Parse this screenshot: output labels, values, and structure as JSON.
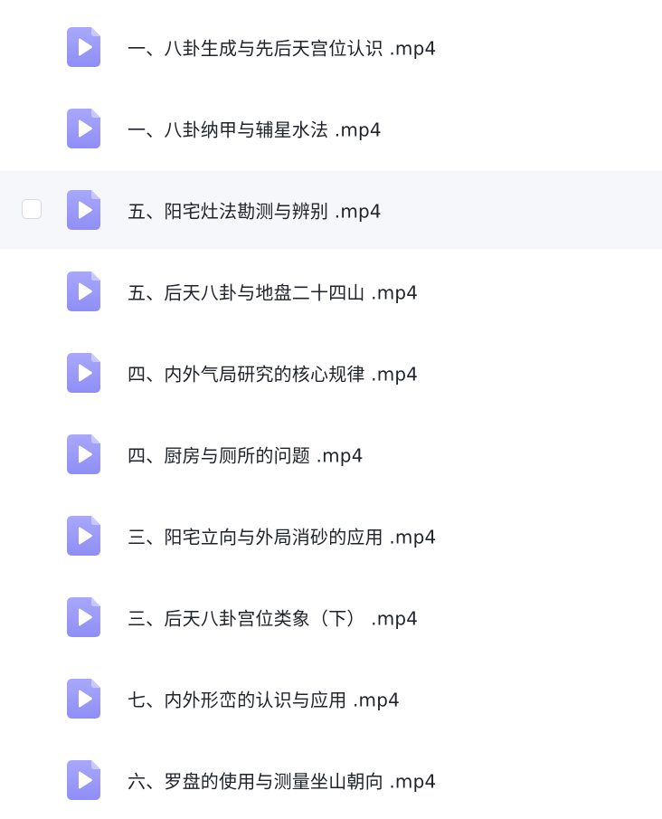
{
  "files": [
    {
      "name": "一、八卦生成与先后天宫位认识 .mp4",
      "icon": "video-file-icon"
    },
    {
      "name": "一、八卦纳甲与辅星水法 .mp4",
      "icon": "video-file-icon"
    },
    {
      "name": "五、阳宅灶法勘测与辨别 .mp4",
      "icon": "video-file-icon",
      "hovered": true
    },
    {
      "name": "五、后天八卦与地盘二十四山 .mp4",
      "icon": "video-file-icon"
    },
    {
      "name": "四、内外气局研究的核心规律 .mp4",
      "icon": "video-file-icon"
    },
    {
      "name": "四、厨房与厕所的问题 .mp4",
      "icon": "video-file-icon"
    },
    {
      "name": "三、阳宅立向与外局消砂的应用 .mp4",
      "icon": "video-file-icon"
    },
    {
      "name": "三、后天八卦宫位类象（下） .mp4",
      "icon": "video-file-icon"
    },
    {
      "name": "七、内外形峦的认识与应用 .mp4",
      "icon": "video-file-icon"
    },
    {
      "name": "六、罗盘的使用与测量坐山朝向 .mp4",
      "icon": "video-file-icon"
    }
  ],
  "colors": {
    "icon_top": "#a9a8fb",
    "icon_bottom": "#8f8ef5",
    "icon_fold": "#c9c8fd",
    "hover_background": "#f6f7fb",
    "text": "#1f2329"
  }
}
